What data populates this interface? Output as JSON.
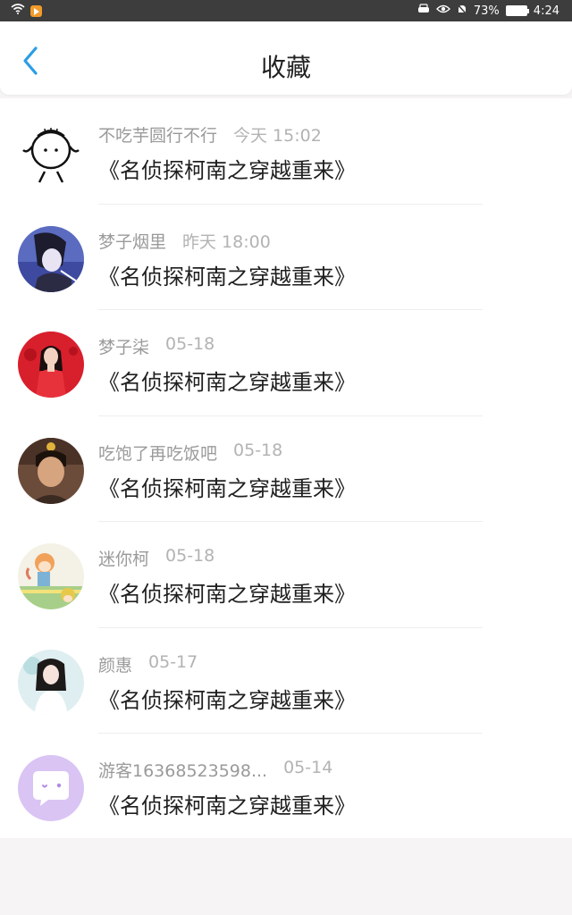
{
  "status_bar": {
    "battery": "73%",
    "time": "4:24"
  },
  "header": {
    "title": "收藏"
  },
  "favorites": [
    {
      "user": "不吃芋圆行不行",
      "time": "今天 15:02",
      "title": "《名侦探柯南之穿越重来》",
      "avatar": "doodle-avatar"
    },
    {
      "user": "梦子烟里",
      "time": "昨天 18:00",
      "title": "《名侦探柯南之穿越重来》",
      "avatar": "anime-avatar"
    },
    {
      "user": "梦子柒",
      "time": "05-18",
      "title": "《名侦探柯南之穿越重来》",
      "avatar": "red-dress-avatar"
    },
    {
      "user": "吃饱了再吃饭吧",
      "time": "05-18",
      "title": "《名侦探柯南之穿越重来》",
      "avatar": "portrait-avatar"
    },
    {
      "user": "迷你柯",
      "time": "05-18",
      "title": "《名侦探柯南之穿越重来》",
      "avatar": "cartoon-avatar"
    },
    {
      "user": "颜惠",
      "time": "05-17",
      "title": "《名侦探柯南之穿越重来》",
      "avatar": "white-dress-avatar"
    },
    {
      "user": "游客16368523598...",
      "time": "05-14",
      "title": "《名侦探柯南之穿越重来》",
      "avatar": "default-chat-avatar"
    }
  ],
  "colors": {
    "accent": "#2a9ee6",
    "default_avatar": "#d9c4f4"
  }
}
